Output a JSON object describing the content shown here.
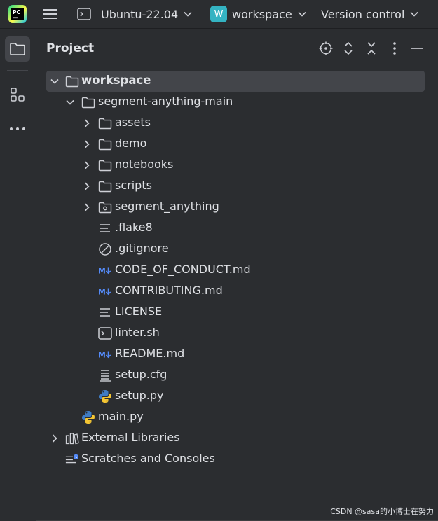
{
  "titlebar": {
    "environment": "Ubuntu-22.04",
    "workspace_badge": "W",
    "workspace": "workspace",
    "version_control": "Version control"
  },
  "panel": {
    "title": "Project"
  },
  "tree": {
    "root": "workspace",
    "project": "segment-anything-main",
    "folders": [
      "assets",
      "demo",
      "notebooks",
      "scripts",
      "segment_anything"
    ],
    "files": [
      ".flake8",
      ".gitignore",
      "CODE_OF_CONDUCT.md",
      "CONTRIBUTING.md",
      "LICENSE",
      "linter.sh",
      "README.md",
      "setup.cfg",
      "setup.py"
    ],
    "root_file": "main.py",
    "external_libraries": "External Libraries",
    "scratches": "Scratches and Consoles"
  },
  "icons": {
    "accent": "#548af7",
    "folder": "#ced0d6",
    "python_blue": "#3f7cc4",
    "python_yellow": "#f5c633"
  },
  "watermark": "CSDN @sasa的小博士在努力"
}
